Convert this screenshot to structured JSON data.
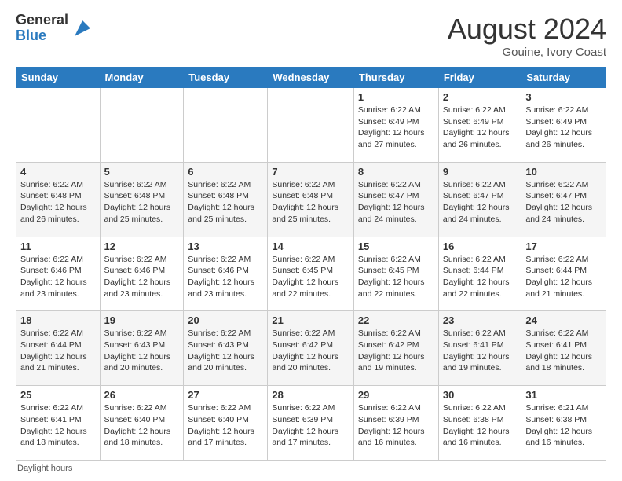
{
  "header": {
    "logo_general": "General",
    "logo_blue": "Blue",
    "month_year": "August 2024",
    "location": "Gouine, Ivory Coast"
  },
  "footer": {
    "daylight_label": "Daylight hours"
  },
  "weekdays": [
    "Sunday",
    "Monday",
    "Tuesday",
    "Wednesday",
    "Thursday",
    "Friday",
    "Saturday"
  ],
  "weeks": [
    [
      {
        "day": "",
        "info": ""
      },
      {
        "day": "",
        "info": ""
      },
      {
        "day": "",
        "info": ""
      },
      {
        "day": "",
        "info": ""
      },
      {
        "day": "1",
        "info": "Sunrise: 6:22 AM\nSunset: 6:49 PM\nDaylight: 12 hours and 27 minutes."
      },
      {
        "day": "2",
        "info": "Sunrise: 6:22 AM\nSunset: 6:49 PM\nDaylight: 12 hours and 26 minutes."
      },
      {
        "day": "3",
        "info": "Sunrise: 6:22 AM\nSunset: 6:49 PM\nDaylight: 12 hours and 26 minutes."
      }
    ],
    [
      {
        "day": "4",
        "info": "Sunrise: 6:22 AM\nSunset: 6:48 PM\nDaylight: 12 hours and 26 minutes."
      },
      {
        "day": "5",
        "info": "Sunrise: 6:22 AM\nSunset: 6:48 PM\nDaylight: 12 hours and 25 minutes."
      },
      {
        "day": "6",
        "info": "Sunrise: 6:22 AM\nSunset: 6:48 PM\nDaylight: 12 hours and 25 minutes."
      },
      {
        "day": "7",
        "info": "Sunrise: 6:22 AM\nSunset: 6:48 PM\nDaylight: 12 hours and 25 minutes."
      },
      {
        "day": "8",
        "info": "Sunrise: 6:22 AM\nSunset: 6:47 PM\nDaylight: 12 hours and 24 minutes."
      },
      {
        "day": "9",
        "info": "Sunrise: 6:22 AM\nSunset: 6:47 PM\nDaylight: 12 hours and 24 minutes."
      },
      {
        "day": "10",
        "info": "Sunrise: 6:22 AM\nSunset: 6:47 PM\nDaylight: 12 hours and 24 minutes."
      }
    ],
    [
      {
        "day": "11",
        "info": "Sunrise: 6:22 AM\nSunset: 6:46 PM\nDaylight: 12 hours and 23 minutes."
      },
      {
        "day": "12",
        "info": "Sunrise: 6:22 AM\nSunset: 6:46 PM\nDaylight: 12 hours and 23 minutes."
      },
      {
        "day": "13",
        "info": "Sunrise: 6:22 AM\nSunset: 6:46 PM\nDaylight: 12 hours and 23 minutes."
      },
      {
        "day": "14",
        "info": "Sunrise: 6:22 AM\nSunset: 6:45 PM\nDaylight: 12 hours and 22 minutes."
      },
      {
        "day": "15",
        "info": "Sunrise: 6:22 AM\nSunset: 6:45 PM\nDaylight: 12 hours and 22 minutes."
      },
      {
        "day": "16",
        "info": "Sunrise: 6:22 AM\nSunset: 6:44 PM\nDaylight: 12 hours and 22 minutes."
      },
      {
        "day": "17",
        "info": "Sunrise: 6:22 AM\nSunset: 6:44 PM\nDaylight: 12 hours and 21 minutes."
      }
    ],
    [
      {
        "day": "18",
        "info": "Sunrise: 6:22 AM\nSunset: 6:44 PM\nDaylight: 12 hours and 21 minutes."
      },
      {
        "day": "19",
        "info": "Sunrise: 6:22 AM\nSunset: 6:43 PM\nDaylight: 12 hours and 20 minutes."
      },
      {
        "day": "20",
        "info": "Sunrise: 6:22 AM\nSunset: 6:43 PM\nDaylight: 12 hours and 20 minutes."
      },
      {
        "day": "21",
        "info": "Sunrise: 6:22 AM\nSunset: 6:42 PM\nDaylight: 12 hours and 20 minutes."
      },
      {
        "day": "22",
        "info": "Sunrise: 6:22 AM\nSunset: 6:42 PM\nDaylight: 12 hours and 19 minutes."
      },
      {
        "day": "23",
        "info": "Sunrise: 6:22 AM\nSunset: 6:41 PM\nDaylight: 12 hours and 19 minutes."
      },
      {
        "day": "24",
        "info": "Sunrise: 6:22 AM\nSunset: 6:41 PM\nDaylight: 12 hours and 18 minutes."
      }
    ],
    [
      {
        "day": "25",
        "info": "Sunrise: 6:22 AM\nSunset: 6:41 PM\nDaylight: 12 hours and 18 minutes."
      },
      {
        "day": "26",
        "info": "Sunrise: 6:22 AM\nSunset: 6:40 PM\nDaylight: 12 hours and 18 minutes."
      },
      {
        "day": "27",
        "info": "Sunrise: 6:22 AM\nSunset: 6:40 PM\nDaylight: 12 hours and 17 minutes."
      },
      {
        "day": "28",
        "info": "Sunrise: 6:22 AM\nSunset: 6:39 PM\nDaylight: 12 hours and 17 minutes."
      },
      {
        "day": "29",
        "info": "Sunrise: 6:22 AM\nSunset: 6:39 PM\nDaylight: 12 hours and 16 minutes."
      },
      {
        "day": "30",
        "info": "Sunrise: 6:22 AM\nSunset: 6:38 PM\nDaylight: 12 hours and 16 minutes."
      },
      {
        "day": "31",
        "info": "Sunrise: 6:21 AM\nSunset: 6:38 PM\nDaylight: 12 hours and 16 minutes."
      }
    ]
  ]
}
